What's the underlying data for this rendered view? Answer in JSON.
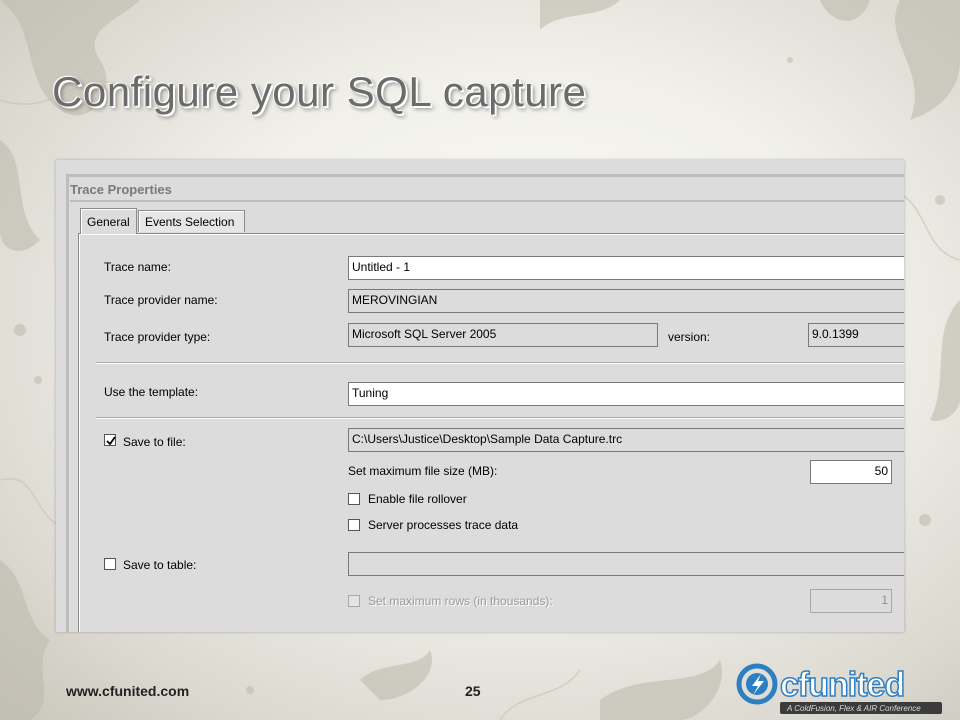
{
  "slide": {
    "title": "Configure your SQL capture",
    "footer_url": "www.cfunited.com",
    "page_number": "25"
  },
  "window": {
    "title": "Trace Properties",
    "tabs": [
      {
        "label": "General",
        "active": true
      },
      {
        "label": "Events Selection",
        "active": false
      }
    ]
  },
  "general": {
    "trace_name_label": "Trace name:",
    "trace_name_value": "Untitled - 1",
    "provider_name_label": "Trace provider name:",
    "provider_name_value": "MEROVINGIAN",
    "provider_type_label": "Trace provider type:",
    "provider_type_value": "Microsoft SQL Server 2005",
    "version_label": "version:",
    "version_value": "9.0.1399",
    "template_label": "Use the template:",
    "template_value": "Tuning",
    "save_to_file_label": "Save to file:",
    "save_to_file_checked": true,
    "file_path_value": "C:\\Users\\Justice\\Desktop\\Sample Data Capture.trc",
    "max_file_size_label": "Set maximum file size (MB):",
    "max_file_size_value": "50",
    "enable_rollover_label": "Enable file rollover",
    "enable_rollover_checked": false,
    "server_processes_label": "Server processes trace data",
    "server_processes_checked": false,
    "save_to_table_label": "Save to table:",
    "save_to_table_checked": false,
    "table_value": "",
    "max_rows_label": "Set maximum rows (in thousands):",
    "max_rows_checked": false,
    "max_rows_value": "1"
  },
  "colors": {
    "dialog_bg": "#dcdcdc",
    "title_gray": "#6b6b6b",
    "logo_blue": "#2d7fc1"
  },
  "logo": {
    "brand_text": "cfunited",
    "tagline": "A ColdFusion, Flex & AIR Conference"
  }
}
